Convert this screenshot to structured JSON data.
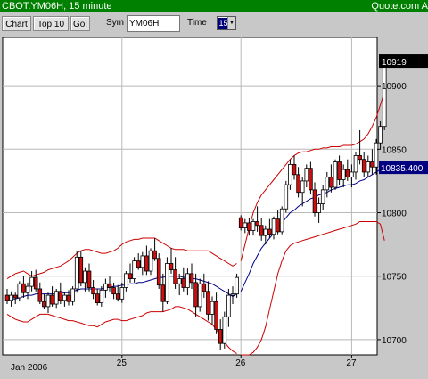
{
  "titlebar": {
    "title": "CBOT:YM06H, 15 minute",
    "right": "Quote.com  A"
  },
  "toolbar": {
    "chart_label": "Chart",
    "top10_label": "Top 10",
    "go_label": "Go!",
    "sym_label": "Sym",
    "sym_value": "YM06H",
    "time_label": "Time",
    "time_value": "15"
  },
  "colors": {
    "up": "#ffffff",
    "down": "#cc1010",
    "band": "#cc0000",
    "mid": "#00008b",
    "last": "#000080"
  },
  "chart_data": {
    "type": "candlestick",
    "title": "",
    "xlabel": "",
    "ylabel": "",
    "ylim": [
      10688,
      10938
    ],
    "yticks": [
      10700,
      10750,
      10800,
      10850,
      10900
    ],
    "xtick_labels": [
      "25",
      "26",
      "27"
    ],
    "date_label": "Jan 2006",
    "last_price_label": "10919",
    "price_tag_label": "10835.400",
    "bars": [
      [
        10735,
        10740,
        10728,
        10731
      ],
      [
        10731,
        10738,
        10726,
        10735
      ],
      [
        10735,
        10737,
        10728,
        10733
      ],
      [
        10733,
        10746,
        10730,
        10744
      ],
      [
        10744,
        10750,
        10733,
        10737
      ],
      [
        10737,
        10745,
        10732,
        10742
      ],
      [
        10742,
        10754,
        10738,
        10749
      ],
      [
        10749,
        10755,
        10738,
        10740
      ],
      [
        10740,
        10745,
        10728,
        10730
      ],
      [
        10730,
        10736,
        10724,
        10726
      ],
      [
        10726,
        10737,
        10721,
        10735
      ],
      [
        10735,
        10742,
        10726,
        10728
      ],
      [
        10728,
        10740,
        10725,
        10738
      ],
      [
        10738,
        10745,
        10728,
        10731
      ],
      [
        10731,
        10737,
        10726,
        10735
      ],
      [
        10735,
        10739,
        10727,
        10730
      ],
      [
        10730,
        10742,
        10727,
        10740
      ],
      [
        10740,
        10770,
        10737,
        10765
      ],
      [
        10765,
        10770,
        10742,
        10745
      ],
      [
        10745,
        10757,
        10738,
        10754
      ],
      [
        10754,
        10760,
        10738,
        10741
      ],
      [
        10741,
        10747,
        10732,
        10736
      ],
      [
        10736,
        10740,
        10727,
        10729
      ],
      [
        10729,
        10742,
        10726,
        10739
      ],
      [
        10739,
        10748,
        10733,
        10744
      ],
      [
        10744,
        10750,
        10738,
        10741
      ],
      [
        10741,
        10745,
        10732,
        10736
      ],
      [
        10736,
        10743,
        10730,
        10732
      ],
      [
        10732,
        10745,
        10729,
        10741
      ],
      [
        10741,
        10754,
        10738,
        10752
      ],
      [
        10752,
        10760,
        10745,
        10748
      ],
      [
        10748,
        10765,
        10745,
        10762
      ],
      [
        10762,
        10768,
        10755,
        10757
      ],
      [
        10757,
        10769,
        10751,
        10766
      ],
      [
        10766,
        10774,
        10751,
        10754
      ],
      [
        10754,
        10772,
        10751,
        10770
      ],
      [
        10770,
        10780,
        10762,
        10764
      ],
      [
        10764,
        10768,
        10740,
        10743
      ],
      [
        10743,
        10752,
        10722,
        10730
      ],
      [
        10730,
        10765,
        10728,
        10760
      ],
      [
        10760,
        10772,
        10752,
        10755
      ],
      [
        10755,
        10765,
        10740,
        10744
      ],
      [
        10744,
        10752,
        10735,
        10748
      ],
      [
        10748,
        10757,
        10738,
        10741
      ],
      [
        10741,
        10756,
        10735,
        10752
      ],
      [
        10752,
        10760,
        10740,
        10745
      ],
      [
        10745,
        10752,
        10718,
        10726
      ],
      [
        10726,
        10748,
        10722,
        10744
      ],
      [
        10744,
        10752,
        10733,
        10738
      ],
      [
        10738,
        10746,
        10715,
        10720
      ],
      [
        10720,
        10734,
        10712,
        10730
      ],
      [
        10730,
        10737,
        10705,
        10708
      ],
      [
        10708,
        10716,
        10692,
        10697
      ],
      [
        10697,
        10722,
        10693,
        10718
      ],
      [
        10718,
        10740,
        10710,
        10735
      ],
      [
        10735,
        10742,
        10728,
        10736
      ],
      [
        10736,
        10752,
        10733,
        10749
      ],
      [
        10796,
        10798,
        10786,
        10788
      ],
      [
        10788,
        10795,
        10784,
        10792
      ],
      [
        10792,
        10796,
        10782,
        10786
      ],
      [
        10786,
        10795,
        10782,
        10793
      ],
      [
        10793,
        10805,
        10785,
        10790
      ],
      [
        10790,
        10796,
        10778,
        10782
      ],
      [
        10782,
        10790,
        10775,
        10787
      ],
      [
        10787,
        10795,
        10780,
        10783
      ],
      [
        10783,
        10797,
        10779,
        10795
      ],
      [
        10795,
        10802,
        10783,
        10785
      ],
      [
        10785,
        10805,
        10783,
        10803
      ],
      [
        10803,
        10825,
        10800,
        10822
      ],
      [
        10822,
        10842,
        10818,
        10838
      ],
      [
        10838,
        10845,
        10826,
        10830
      ],
      [
        10830,
        10836,
        10812,
        10816
      ],
      [
        10816,
        10828,
        10805,
        10825
      ],
      [
        10825,
        10838,
        10820,
        10835
      ],
      [
        10835,
        10840,
        10815,
        10818
      ],
      [
        10818,
        10824,
        10797,
        10800
      ],
      [
        10800,
        10812,
        10792,
        10807
      ],
      [
        10807,
        10822,
        10802,
        10818
      ],
      [
        10818,
        10832,
        10812,
        10828
      ],
      [
        10828,
        10838,
        10816,
        10820
      ],
      [
        10820,
        10842,
        10818,
        10840
      ],
      [
        10840,
        10845,
        10822,
        10826
      ],
      [
        10826,
        10838,
        10820,
        10834
      ],
      [
        10834,
        10842,
        10825,
        10828
      ],
      [
        10828,
        10838,
        10820,
        10832
      ],
      [
        10832,
        10848,
        10826,
        10845
      ],
      [
        10845,
        10865,
        10838,
        10842
      ],
      [
        10842,
        10848,
        10828,
        10832
      ],
      [
        10832,
        10845,
        10828,
        10840
      ],
      [
        10840,
        10850,
        10830,
        10836
      ],
      [
        10836,
        10858,
        10830,
        10855
      ],
      [
        10855,
        10872,
        10850,
        10868
      ],
      [
        10868,
        10922,
        10865,
        10919
      ]
    ],
    "bb_upper": [
      10748,
      10750,
      10752,
      10753,
      10754,
      10752,
      10750,
      10751,
      10752,
      10753,
      10755,
      10756,
      10757,
      10758,
      10760,
      10762,
      10765,
      10768,
      10770,
      10771,
      10771,
      10770,
      10769,
      10768,
      10768,
      10769,
      10770,
      10772,
      10775,
      10777,
      10778,
      10779,
      10779,
      10780,
      10780,
      10780,
      10780,
      10778,
      10776,
      10774,
      10772,
      10771,
      10771,
      10771,
      10770,
      10770,
      10770,
      10770,
      10770,
      10770,
      10768,
      10766,
      10764,
      10762,
      10760,
      10758,
      10760,
      10762,
      10775,
      10788,
      10800,
      10808,
      10814,
      10818,
      10822,
      10826,
      10830,
      10834,
      10838,
      10842,
      10845,
      10847,
      10848,
      10848,
      10849,
      10850,
      10850,
      10851,
      10851,
      10852,
      10852,
      10852,
      10853,
      10853,
      10853,
      10854,
      10856,
      10858,
      10862,
      10868,
      10875,
      10885,
      10895
    ],
    "bb_middle": [
      10733,
      10732,
      10732,
      10733,
      10734,
      10735,
      10735,
      10736,
      10736,
      10736,
      10736,
      10736,
      10736,
      10736,
      10737,
      10737,
      10738,
      10739,
      10740,
      10740,
      10740,
      10740,
      10740,
      10740,
      10741,
      10741,
      10742,
      10742,
      10743,
      10743,
      10744,
      10744,
      10745,
      10745,
      10746,
      10747,
      10748,
      10749,
      10749,
      10750,
      10750,
      10750,
      10750,
      10749,
      10749,
      10748,
      10748,
      10747,
      10746,
      10745,
      10744,
      10742,
      10740,
      10738,
      10736,
      10734,
      10736,
      10738,
      10745,
      10752,
      10760,
      10766,
      10772,
      10776,
      10780,
      10784,
      10788,
      10792,
      10796,
      10800,
      10802,
      10805,
      10807,
      10809,
      10811,
      10812,
      10814,
      10815,
      10816,
      10818,
      10819,
      10820,
      10821,
      10822,
      10822,
      10823,
      10825,
      10826,
      10828,
      10830,
      10832,
      10834,
      10836
    ],
    "bb_lower": [
      10720,
      10718,
      10716,
      10715,
      10714,
      10714,
      10716,
      10718,
      10720,
      10720,
      10720,
      10719,
      10718,
      10717,
      10716,
      10715,
      10715,
      10714,
      10713,
      10712,
      10711,
      10711,
      10710,
      10712,
      10714,
      10715,
      10716,
      10716,
      10715,
      10715,
      10716,
      10717,
      10718,
      10719,
      10721,
      10722,
      10722,
      10722,
      10722,
      10723,
      10724,
      10726,
      10726,
      10725,
      10724,
      10722,
      10720,
      10718,
      10716,
      10714,
      10712,
      10708,
      10703,
      10698,
      10694,
      10691,
      10689,
      10688,
      10688,
      10688,
      10690,
      10694,
      10700,
      10710,
      10724,
      10738,
      10752,
      10762,
      10770,
      10774,
      10776,
      10777,
      10778,
      10779,
      10780,
      10781,
      10782,
      10783,
      10784,
      10785,
      10786,
      10787,
      10788,
      10789,
      10790,
      10791,
      10793,
      10793,
      10793,
      10793,
      10793,
      10791,
      10778
    ]
  }
}
